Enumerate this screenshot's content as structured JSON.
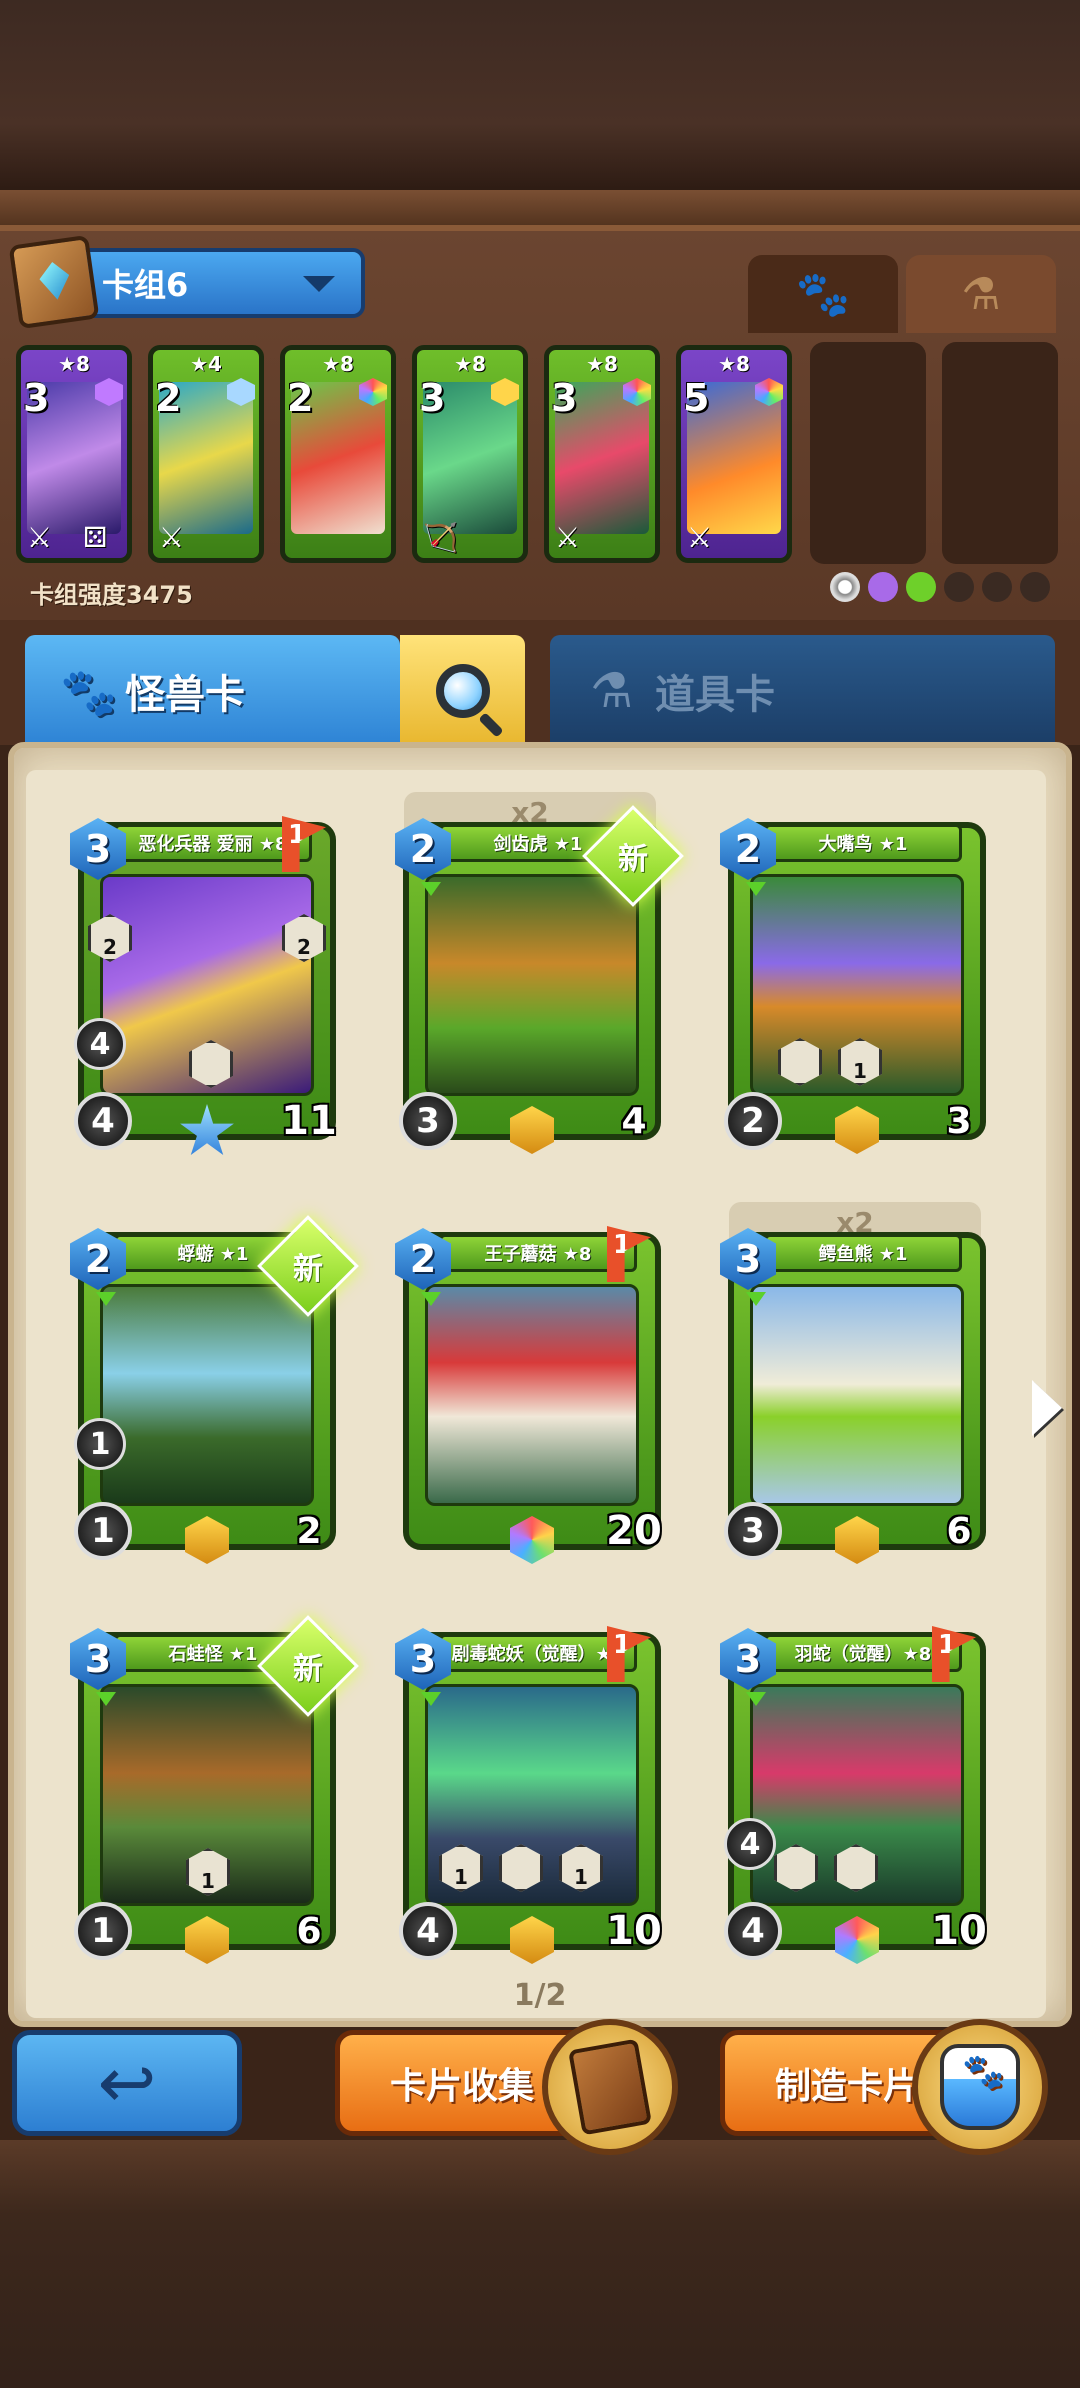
{
  "deck": {
    "name": "卡组6",
    "strength_label": "卡组强度3475",
    "tabs": [
      {
        "icon": "paw-icon",
        "active": true
      },
      {
        "icon": "potion-icon",
        "active": false
      }
    ],
    "cards": [
      {
        "stars": "★8",
        "cost": "3",
        "color": "purple"
      },
      {
        "stars": "★4",
        "cost": "2",
        "color": "green"
      },
      {
        "stars": "★8",
        "cost": "2",
        "color": "green"
      },
      {
        "stars": "★8",
        "cost": "3",
        "color": "green"
      },
      {
        "stars": "★8",
        "cost": "3",
        "color": "green"
      },
      {
        "stars": "★8",
        "cost": "5",
        "color": "purple"
      }
    ]
  },
  "category_tabs": {
    "monster": "怪兽卡",
    "item": "道具卡"
  },
  "collection": {
    "page": "1/2",
    "cards": [
      {
        "name": "恶化兵器 爱丽 ★8",
        "cost": "3",
        "atk": "4",
        "hp": "11",
        "flag": "1",
        "extra_stat": "4",
        "ability_left": "2",
        "ability_right": "2"
      },
      {
        "name": "剑齿虎 ★1",
        "cost": "2",
        "atk": "3",
        "hp": "4",
        "new": "新",
        "dup": "x2"
      },
      {
        "name": "大嘴鸟 ★1",
        "cost": "2",
        "atk": "2",
        "hp": "3",
        "ability_right": "1"
      },
      {
        "name": "蜉蝣 ★1",
        "cost": "2",
        "atk": "1",
        "hp": "2",
        "new": "新",
        "extra_stat": "1"
      },
      {
        "name": "王子蘑菇 ★8",
        "cost": "2",
        "hp": "20",
        "flag": "1"
      },
      {
        "name": "鳄鱼熊 ★1",
        "cost": "3",
        "atk": "3",
        "hp": "6",
        "dup": "x2"
      },
      {
        "name": "石蛙怪 ★1",
        "cost": "3",
        "atk": "1",
        "hp": "6",
        "new": "新",
        "ability_right": "1"
      },
      {
        "name": "剧毒蛇妖（觉醒）★8",
        "cost": "3",
        "atk": "4",
        "hp": "10",
        "flag": "1",
        "ability_left": "1",
        "ability_right": "1"
      },
      {
        "name": "羽蛇（觉醒）★8",
        "cost": "3",
        "atk": "4",
        "hp": "10",
        "flag": "1",
        "extra_stat": "4"
      }
    ]
  },
  "buttons": {
    "collect": "卡片收集",
    "craft": "制造卡片"
  }
}
